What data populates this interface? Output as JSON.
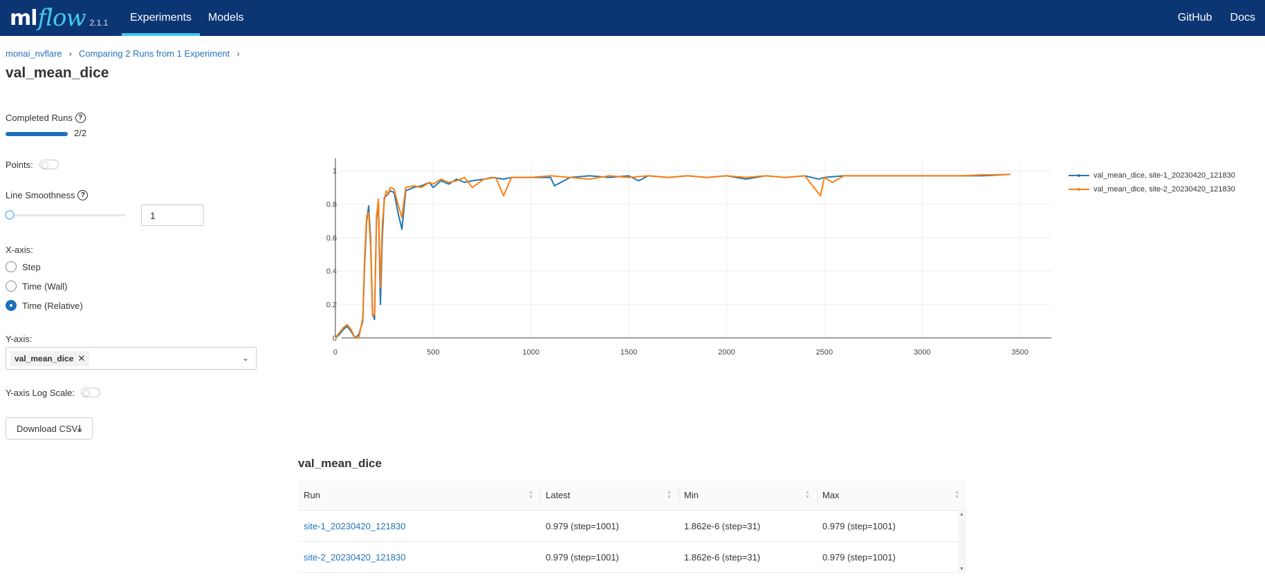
{
  "header": {
    "logo_ml": "ml",
    "logo_flow": "flow",
    "version": "2.1.1",
    "nav": [
      {
        "label": "Experiments",
        "active": true
      },
      {
        "label": "Models",
        "active": false
      }
    ],
    "right_links": [
      "GitHub",
      "Docs"
    ]
  },
  "breadcrumb": {
    "items": [
      "monai_nvflare",
      "Comparing 2 Runs from 1 Experiment"
    ],
    "separator": "›"
  },
  "page_title": "val_mean_dice",
  "controls": {
    "completed_runs_label": "Completed Runs",
    "completed_runs_text": "2/2",
    "completed_runs_fraction": 1.0,
    "points_label": "Points:",
    "points_on": false,
    "smoothness_label": "Line Smoothness",
    "smoothness_value": "1",
    "help_glyph": "?",
    "xaxis_label": "X-axis:",
    "xaxis_options": [
      "Step",
      "Time (Wall)",
      "Time (Relative)"
    ],
    "xaxis_selected": "Time (Relative)",
    "yaxis_label": "Y-axis:",
    "yaxis_tag": "val_mean_dice",
    "yaxis_tag_remove": "✕",
    "dropdown_chevron": "⌄",
    "log_scale_label": "Y-axis Log Scale:",
    "log_scale_on": false,
    "download_label": "Download CSV",
    "download_icon": "⤓"
  },
  "chart_data": {
    "type": "line",
    "xlim": [
      -180,
      3660
    ],
    "ylim": [
      0,
      1.05
    ],
    "x_ticks": [
      "0",
      "500",
      "1000",
      "1500",
      "2000",
      "2500",
      "3000",
      "3500"
    ],
    "y_ticks": [
      "0",
      "0.2",
      "0.4",
      "0.6",
      "0.8",
      "1"
    ],
    "grid": true,
    "legend_position": "right",
    "series": [
      {
        "name": "val_mean_dice, site-1_20230420_121830",
        "color": "#1f77b4",
        "x": [
          0,
          20,
          40,
          60,
          80,
          100,
          120,
          140,
          150,
          160,
          170,
          180,
          190,
          200,
          210,
          220,
          230,
          240,
          250,
          260,
          270,
          280,
          300,
          320,
          340,
          360,
          400,
          440,
          480,
          500,
          540,
          580,
          620,
          660,
          700,
          760,
          800,
          860,
          900,
          1000,
          1100,
          1120,
          1200,
          1300,
          1400,
          1500,
          1550,
          1600,
          1700,
          1800,
          1900,
          2000,
          2100,
          2200,
          2300,
          2400,
          2470,
          2500,
          2600,
          2700,
          2800,
          2900,
          3000,
          3100,
          3200,
          3300,
          3400,
          3450
        ],
        "y": [
          0.0,
          0.02,
          0.05,
          0.07,
          0.04,
          0.0,
          0.02,
          0.1,
          0.45,
          0.7,
          0.79,
          0.6,
          0.15,
          0.11,
          0.7,
          0.81,
          0.2,
          0.6,
          0.84,
          0.85,
          0.86,
          0.88,
          0.87,
          0.75,
          0.65,
          0.88,
          0.9,
          0.91,
          0.93,
          0.9,
          0.94,
          0.92,
          0.95,
          0.93,
          0.94,
          0.95,
          0.96,
          0.95,
          0.96,
          0.96,
          0.96,
          0.91,
          0.96,
          0.97,
          0.96,
          0.97,
          0.94,
          0.97,
          0.96,
          0.97,
          0.96,
          0.97,
          0.95,
          0.97,
          0.96,
          0.97,
          0.95,
          0.96,
          0.97,
          0.97,
          0.97,
          0.97,
          0.97,
          0.97,
          0.97,
          0.97,
          0.975,
          0.979
        ]
      },
      {
        "name": "val_mean_dice, site-2_20230420_121830",
        "color": "#ff7f0e",
        "x": [
          0,
          20,
          40,
          60,
          80,
          100,
          120,
          140,
          150,
          160,
          170,
          180,
          190,
          200,
          210,
          220,
          230,
          240,
          250,
          260,
          270,
          280,
          300,
          320,
          340,
          360,
          400,
          440,
          480,
          500,
          540,
          580,
          620,
          660,
          700,
          760,
          820,
          860,
          900,
          1000,
          1100,
          1200,
          1300,
          1400,
          1500,
          1600,
          1700,
          1800,
          1900,
          2000,
          2100,
          2200,
          2300,
          2400,
          2480,
          2500,
          2540,
          2600,
          2700,
          2800,
          2900,
          3000,
          3100,
          3200,
          3300,
          3400,
          3450
        ],
        "y": [
          0.0,
          0.03,
          0.06,
          0.08,
          0.05,
          0.0,
          0.0,
          0.12,
          0.5,
          0.73,
          0.75,
          0.55,
          0.13,
          0.14,
          0.72,
          0.83,
          0.3,
          0.68,
          0.82,
          0.88,
          0.86,
          0.9,
          0.89,
          0.8,
          0.72,
          0.9,
          0.91,
          0.9,
          0.93,
          0.92,
          0.95,
          0.93,
          0.94,
          0.96,
          0.9,
          0.95,
          0.96,
          0.85,
          0.96,
          0.96,
          0.97,
          0.96,
          0.95,
          0.97,
          0.96,
          0.97,
          0.96,
          0.97,
          0.96,
          0.97,
          0.96,
          0.97,
          0.96,
          0.97,
          0.85,
          0.96,
          0.93,
          0.97,
          0.97,
          0.97,
          0.97,
          0.97,
          0.97,
          0.97,
          0.975,
          0.977,
          0.979
        ]
      }
    ]
  },
  "table": {
    "title": "val_mean_dice",
    "columns": [
      "Run",
      "Latest",
      "Min",
      "Max"
    ],
    "rows": [
      {
        "run": "site-1_20230420_121830",
        "latest": "0.979 (step=1001)",
        "min": "1.862e-6 (step=31)",
        "max": "0.979 (step=1001)"
      },
      {
        "run": "site-2_20230420_121830",
        "latest": "0.979 (step=1001)",
        "min": "1.862e-6 (step=31)",
        "max": "0.979 (step=1001)"
      }
    ],
    "sort_up": "▲",
    "sort_down": "▼"
  }
}
